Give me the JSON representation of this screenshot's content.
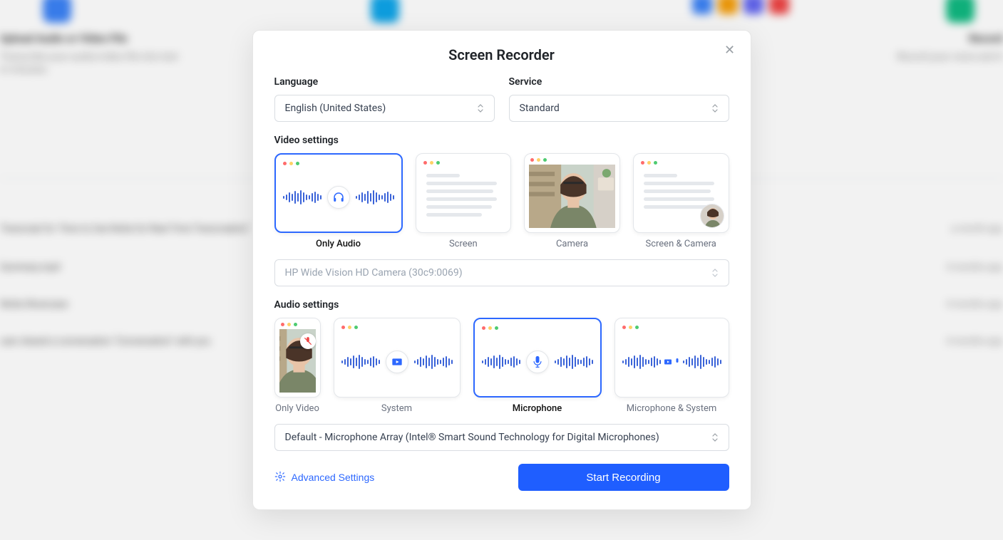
{
  "background": {
    "card_title": "Upload Audio or Video File",
    "card_sub1": "Transcribe your audio/video file into text",
    "card_sub2": "in minutes.",
    "right_label": "Record",
    "right_sub": "Record your voice and it",
    "row1_left": "Transcript for \"How to Use Notta for Real-Time Transcription\"",
    "row1_right": "a month ago",
    "row2_left": "Summary.mp4",
    "row2_right": "4 months ago",
    "row3_left": "Notta Showcase",
    "row3_right": "4 months ago",
    "row4_left": "user shared a conversation \"Conversation\" with you",
    "row4_right": "4 months ago"
  },
  "modal": {
    "title": "Screen Recorder",
    "language_label": "Language",
    "language_value": "English (United States)",
    "service_label": "Service",
    "service_value": "Standard",
    "video_section": "Video settings",
    "video_options": [
      "Only Audio",
      "Screen",
      "Camera",
      "Screen & Camera"
    ],
    "camera_device": "HP Wide Vision HD Camera (30c9:0069)",
    "audio_section": "Audio settings",
    "audio_options": [
      "Only Video",
      "System",
      "Microphone",
      "Microphone & System"
    ],
    "mic_device": "Default - Microphone Array (Intel® Smart Sound Technology for Digital Microphones)",
    "advanced": "Advanced Settings",
    "start": "Start Recording"
  }
}
